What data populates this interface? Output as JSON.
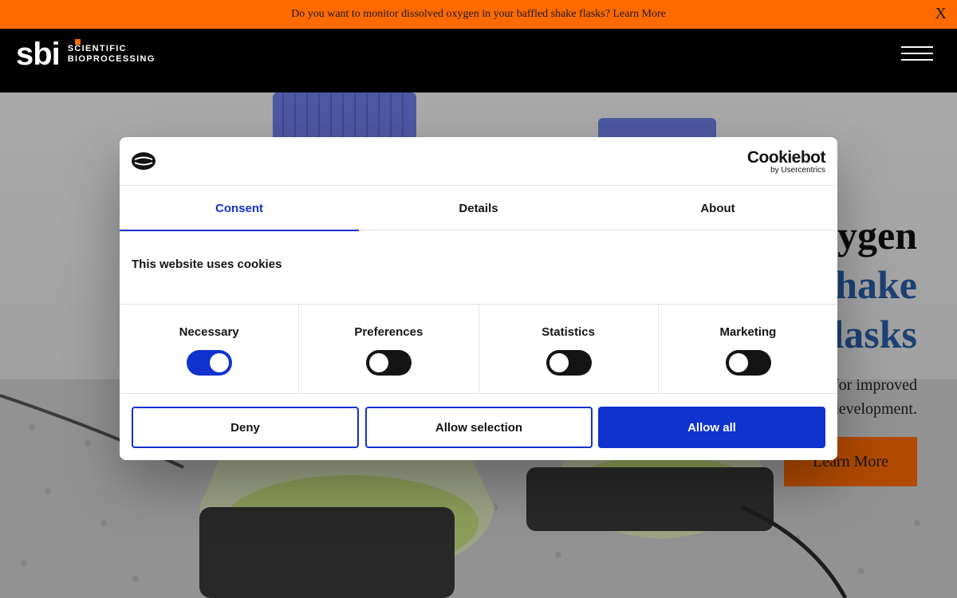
{
  "announcement": {
    "text": "Do you want to monitor dissolved oxygen in your baffled shake flasks? Learn More",
    "close_label": "X"
  },
  "header": {
    "logo_mark": "sbi",
    "logo_line1": "SCIENTIFIC",
    "logo_line2": "BIOPROCESSING",
    "menu_icon": "hamburger-menu-icon",
    "accent": "#ff6a00"
  },
  "hero": {
    "title_line1": "ygen",
    "title_line2": "hake",
    "title_line3": "lasks",
    "subtitle_line1": "for improved",
    "subtitle_line2": "development.",
    "cta_label": "Learn More",
    "title_color": "#2a5ea8"
  },
  "cookie_dialog": {
    "brand_name": "Cookiebot",
    "brand_by": "by Usercentrics",
    "tabs": [
      {
        "label": "Consent",
        "active": true
      },
      {
        "label": "Details",
        "active": false
      },
      {
        "label": "About",
        "active": false
      }
    ],
    "heading": "This website uses cookies",
    "categories": [
      {
        "label": "Necessary",
        "enabled": true
      },
      {
        "label": "Preferences",
        "enabled": false
      },
      {
        "label": "Statistics",
        "enabled": false
      },
      {
        "label": "Marketing",
        "enabled": false
      }
    ],
    "buttons": {
      "deny": "Deny",
      "allow_selection": "Allow selection",
      "allow_all": "Allow all"
    },
    "accent": "#1032cf"
  }
}
